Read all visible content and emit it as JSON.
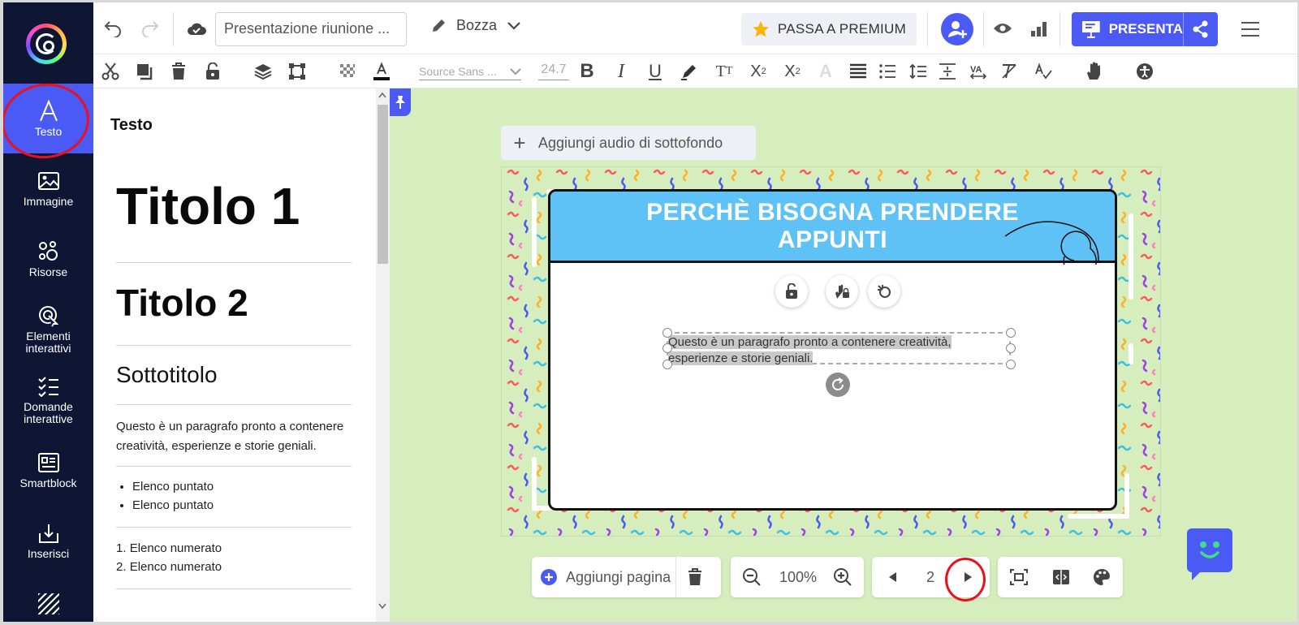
{
  "nav": [
    {
      "label": "Testo",
      "icon": "text-icon",
      "active": true
    },
    {
      "label": "Immagine",
      "icon": "image-icon"
    },
    {
      "label": "Risorse",
      "icon": "resources-icon"
    },
    {
      "label": "Elementi interattivi",
      "icon": "interactive-elements-icon"
    },
    {
      "label": "Domande interattive",
      "icon": "interactive-questions-icon"
    },
    {
      "label": "Smartblock",
      "icon": "smartblock-icon"
    },
    {
      "label": "Inserisci",
      "icon": "insert-icon"
    }
  ],
  "topbar": {
    "title_value": "Presentazione riunione ...",
    "status_label": "Bozza",
    "premium_label": "PASSA A PREMIUM",
    "present_label": "PRESENTA"
  },
  "format": {
    "font_family": "Source Sans ...",
    "font_size": "24.7"
  },
  "panel": {
    "heading": "Testo",
    "title1": "Titolo 1",
    "title2": "Titolo 2",
    "subtitle": "Sottotitolo",
    "paragraph": "Questo è un paragrafo pronto a contenere creatività, esperienze e storie geniali.",
    "bullets": [
      "Elenco puntato",
      "Elenco puntato"
    ],
    "numbered": [
      "Elenco numerato",
      "Elenco numerato"
    ]
  },
  "canvas": {
    "audio_label": "Aggiungi audio di sottofondo",
    "slide_title_line1": "PERCHÈ BISOGNA PRENDERE",
    "slide_title_line2": "APPUNTI",
    "selected_text_line1": "Questo è un paragrafo pronto a contenere creatività,",
    "selected_text_line2": "esperienze e storie geniali."
  },
  "bottombar": {
    "add_page_label": "Aggiungi pagina",
    "zoom": "100%",
    "page": "2"
  },
  "colors": {
    "accent": "#4b5af5",
    "nav_bg": "#0e1634",
    "canvas_bg": "#d6edbe",
    "slide_header": "#5ec2f7",
    "annotation": "#e8111c"
  }
}
